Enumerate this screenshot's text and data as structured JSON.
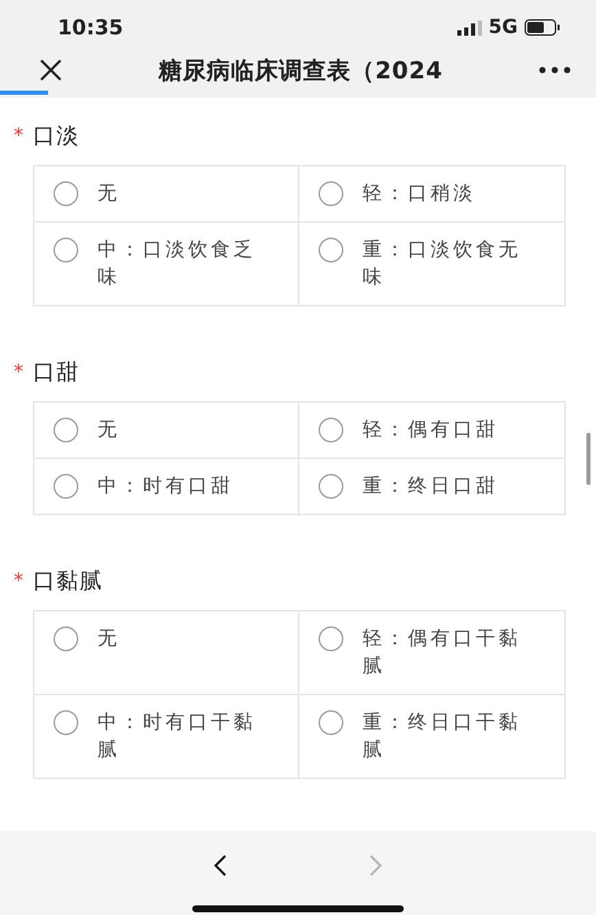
{
  "status_bar": {
    "time": "10:35",
    "network": "5G"
  },
  "nav_bar": {
    "title": "糖尿病临床调查表（2024",
    "progress": {
      "level": 0.08
    }
  },
  "questions": [
    {
      "marker": "*",
      "title": "口淡",
      "options": [
        {
          "label": "无",
          "selected": false
        },
        {
          "label": "轻：口稍淡",
          "selected": false
        },
        {
          "label": "中：口淡饮食乏味",
          "selected": false
        },
        {
          "label": "重：口淡饮食无味",
          "selected": false
        }
      ]
    },
    {
      "marker": "*",
      "title": "口甜",
      "options": [
        {
          "label": "无",
          "selected": false
        },
        {
          "label": "轻：偶有口甜",
          "selected": false
        },
        {
          "label": "中：时有口甜",
          "selected": false
        },
        {
          "label": "重：终日口甜",
          "selected": false
        }
      ]
    },
    {
      "marker": "*",
      "title": "口黏腻",
      "options": [
        {
          "label": "无",
          "selected": false
        },
        {
          "label": "轻：偶有口干黏腻",
          "selected": false
        },
        {
          "label": "中：时有口干黏腻",
          "selected": false
        },
        {
          "label": "重：终日口干黏腻",
          "selected": false
        }
      ]
    }
  ],
  "toolbar": {
    "back": {
      "disabled": false
    },
    "forward": {
      "disabled": true
    }
  }
}
